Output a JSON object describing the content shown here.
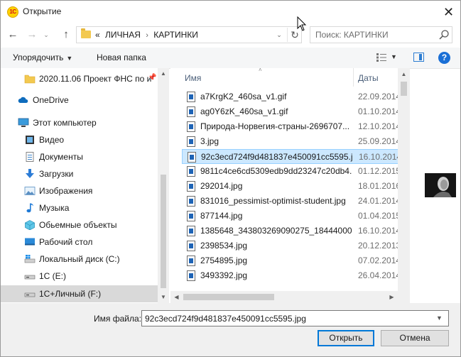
{
  "window": {
    "title": "Открытие",
    "close_glyph": "✕",
    "app_icon_text": "1С"
  },
  "address": {
    "prefix": "«",
    "crumbs": [
      "ЛИЧНАЯ",
      "КАРТИНКИ"
    ],
    "separator": "›"
  },
  "search": {
    "placeholder": "Поиск: КАРТИНКИ"
  },
  "toolbar": {
    "organize_label": "Упорядочить",
    "organize_caret": "▼",
    "new_folder_label": "Новая папка",
    "help_glyph": "?"
  },
  "nav_pane": {
    "items": [
      {
        "label": "2020.11.06 Проект ФНС по и",
        "icon": "folder-icon"
      },
      {
        "label": "OneDrive",
        "icon": "cloud-icon"
      },
      {
        "label": "Этот компьютер",
        "icon": "computer-icon"
      },
      {
        "label": "Видео",
        "icon": "video-icon"
      },
      {
        "label": "Документы",
        "icon": "documents-icon"
      },
      {
        "label": "Загрузки",
        "icon": "download-icon"
      },
      {
        "label": "Изображения",
        "icon": "pictures-icon"
      },
      {
        "label": "Музыка",
        "icon": "music-icon"
      },
      {
        "label": "Обьемные объекты",
        "icon": "3d-objects-icon"
      },
      {
        "label": "Рабочий стол",
        "icon": "desktop-icon"
      },
      {
        "label": "Локальный диск (C:)",
        "icon": "windows-drive-icon"
      },
      {
        "label": "1С (E:)",
        "icon": "drive-icon"
      },
      {
        "label": "1С+Личный (F:)",
        "icon": "drive-icon"
      }
    ],
    "selected_index": 12
  },
  "file_list": {
    "columns": {
      "name": "Имя",
      "date": "Даты"
    },
    "files": [
      {
        "name": "a7KrgK2_460sa_v1.gif",
        "date": "22.09.2014"
      },
      {
        "name": "ag0Y6zK_460sa_v1.gif",
        "date": "01.10.2014"
      },
      {
        "name": "Природа-Норвегия-страны-2696707...",
        "date": "12.10.2014"
      },
      {
        "name": "3.jpg",
        "date": "25.09.2014"
      },
      {
        "name": "92c3ecd724f9d481837e450091cc5595.j...",
        "date": "16.10.2014"
      },
      {
        "name": "9811c4ce6cd5309edb9dd23247c20db4...",
        "date": "01.12.2015"
      },
      {
        "name": "292014.jpg",
        "date": "18.01.2016"
      },
      {
        "name": "831016_pessimist-optimist-student.jpg",
        "date": "24.01.2014"
      },
      {
        "name": "877144.jpg",
        "date": "01.04.2015"
      },
      {
        "name": "1385648_343803269090275_184440004...",
        "date": "16.10.2014"
      },
      {
        "name": "2398534.jpg",
        "date": "20.12.2013"
      },
      {
        "name": "2754895.jpg",
        "date": "07.02.2014"
      },
      {
        "name": "3493392.jpg",
        "date": "26.04.2014"
      }
    ],
    "selected_index": 4
  },
  "bottom": {
    "filename_label": "Имя файла:",
    "filename_value": "92c3ecd724f9d481837e450091cc5595.jpg",
    "open_label": "Открыть",
    "cancel_label": "Отмена"
  }
}
